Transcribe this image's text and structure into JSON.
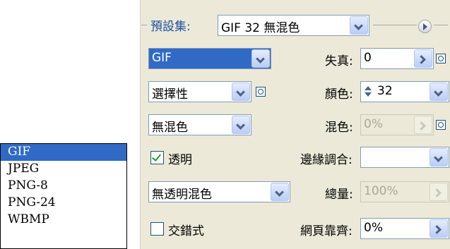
{
  "preset": {
    "label": "預設集:",
    "value": "GIF 32 無混色"
  },
  "rows": {
    "format": {
      "value": "GIF"
    },
    "lossy": {
      "label": "失真:",
      "value": "0"
    },
    "reduction": {
      "value": "選擇性"
    },
    "colors": {
      "label": "顏色:",
      "value": "32"
    },
    "dither_method": {
      "value": "無混色"
    },
    "dither": {
      "label": "混色:",
      "value": "0%"
    },
    "transparency": {
      "label": "透明",
      "checked": true
    },
    "matte": {
      "label": "邊緣調合:",
      "value": ""
    },
    "transparency_dither": {
      "value": "無透明混色"
    },
    "amount": {
      "label": "總量:",
      "value": "100%"
    },
    "interlaced": {
      "label": "交錯式",
      "checked": false
    },
    "web_snap": {
      "label": "網頁靠齊:",
      "value": "0%"
    }
  },
  "format_dropdown": {
    "options": [
      "GIF",
      "JPEG",
      "PNG-8",
      "PNG-24",
      "WBMP"
    ],
    "selected": "GIF"
  },
  "colors_theme": {
    "selection": "#316ac5",
    "panel": "#ece9d8",
    "border": "#7f9db9"
  }
}
